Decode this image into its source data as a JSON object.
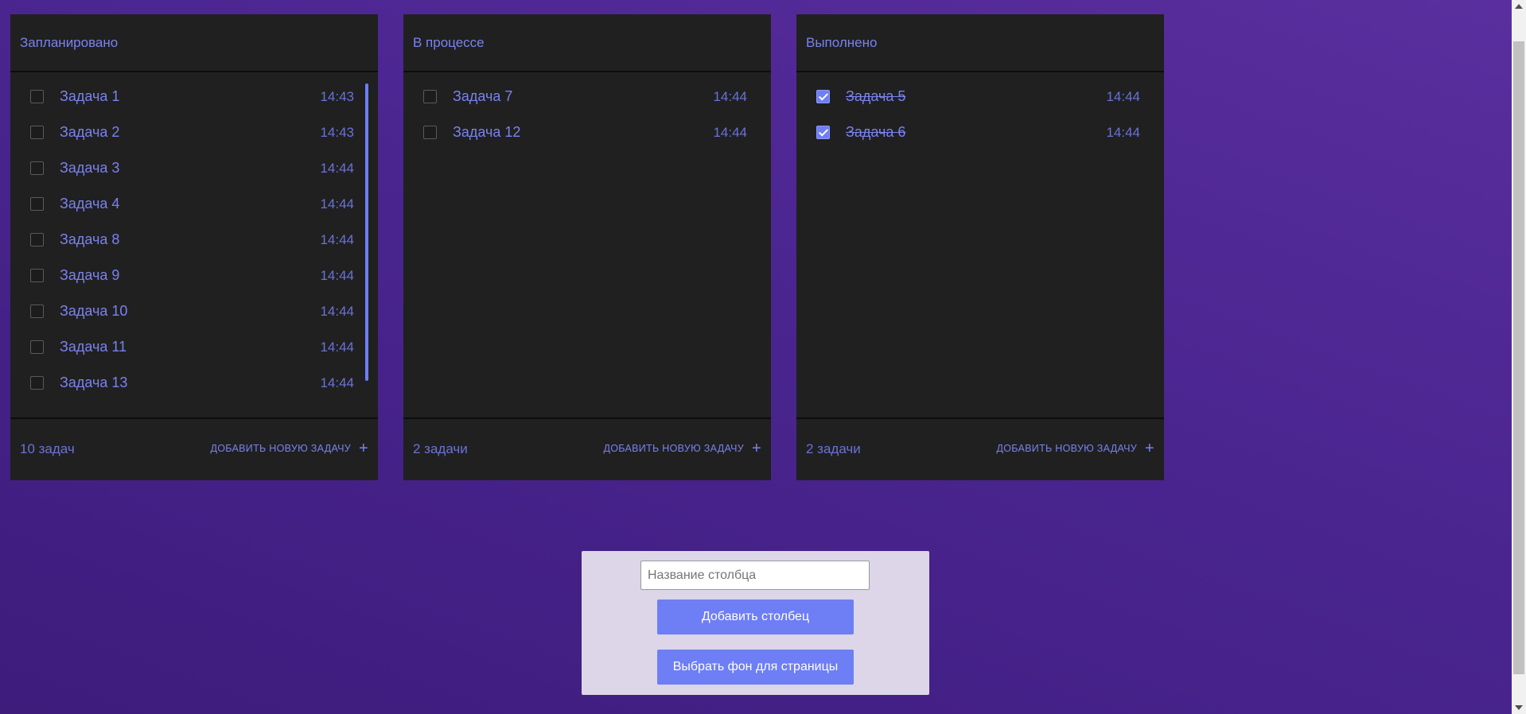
{
  "columns": [
    {
      "title": "Запланировано",
      "count": "10 задач",
      "add_label": "ДОБАВИТЬ НОВУЮ ЗАДАЧУ",
      "has_scrollbar": true,
      "tasks": [
        {
          "name": "Задача 1",
          "time": "14:43",
          "done": false
        },
        {
          "name": "Задача 2",
          "time": "14:43",
          "done": false
        },
        {
          "name": "Задача 3",
          "time": "14:44",
          "done": false
        },
        {
          "name": "Задача 4",
          "time": "14:44",
          "done": false
        },
        {
          "name": "Задача 8",
          "time": "14:44",
          "done": false
        },
        {
          "name": "Задача 9",
          "time": "14:44",
          "done": false
        },
        {
          "name": "Задача 10",
          "time": "14:44",
          "done": false
        },
        {
          "name": "Задача 11",
          "time": "14:44",
          "done": false
        },
        {
          "name": "Задача 13",
          "time": "14:44",
          "done": false
        }
      ]
    },
    {
      "title": "В процессе",
      "count": "2 задачи",
      "add_label": "ДОБАВИТЬ НОВУЮ ЗАДАЧУ",
      "has_scrollbar": false,
      "tasks": [
        {
          "name": "Задача 7",
          "time": "14:44",
          "done": false
        },
        {
          "name": "Задача 12",
          "time": "14:44",
          "done": false
        }
      ]
    },
    {
      "title": "Выполнено",
      "count": "2 задачи",
      "add_label": "ДОБАВИТЬ НОВУЮ ЗАДАЧУ",
      "has_scrollbar": false,
      "tasks": [
        {
          "name": "Задача 5",
          "time": "14:44",
          "done": true
        },
        {
          "name": "Задача 6",
          "time": "14:44",
          "done": true
        }
      ]
    }
  ],
  "panel": {
    "input_placeholder": "Название столбца",
    "input_value": "",
    "add_column_label": "Добавить столбец",
    "choose_bg_label": "Выбрать фон для страницы"
  },
  "colors": {
    "accent": "#6e7ef5",
    "text_accent": "#7a82f0",
    "column_bg": "#202020",
    "panel_bg": "#dcd6e8"
  },
  "icons": {
    "add": "plus-icon",
    "check": "checkmark-icon"
  }
}
